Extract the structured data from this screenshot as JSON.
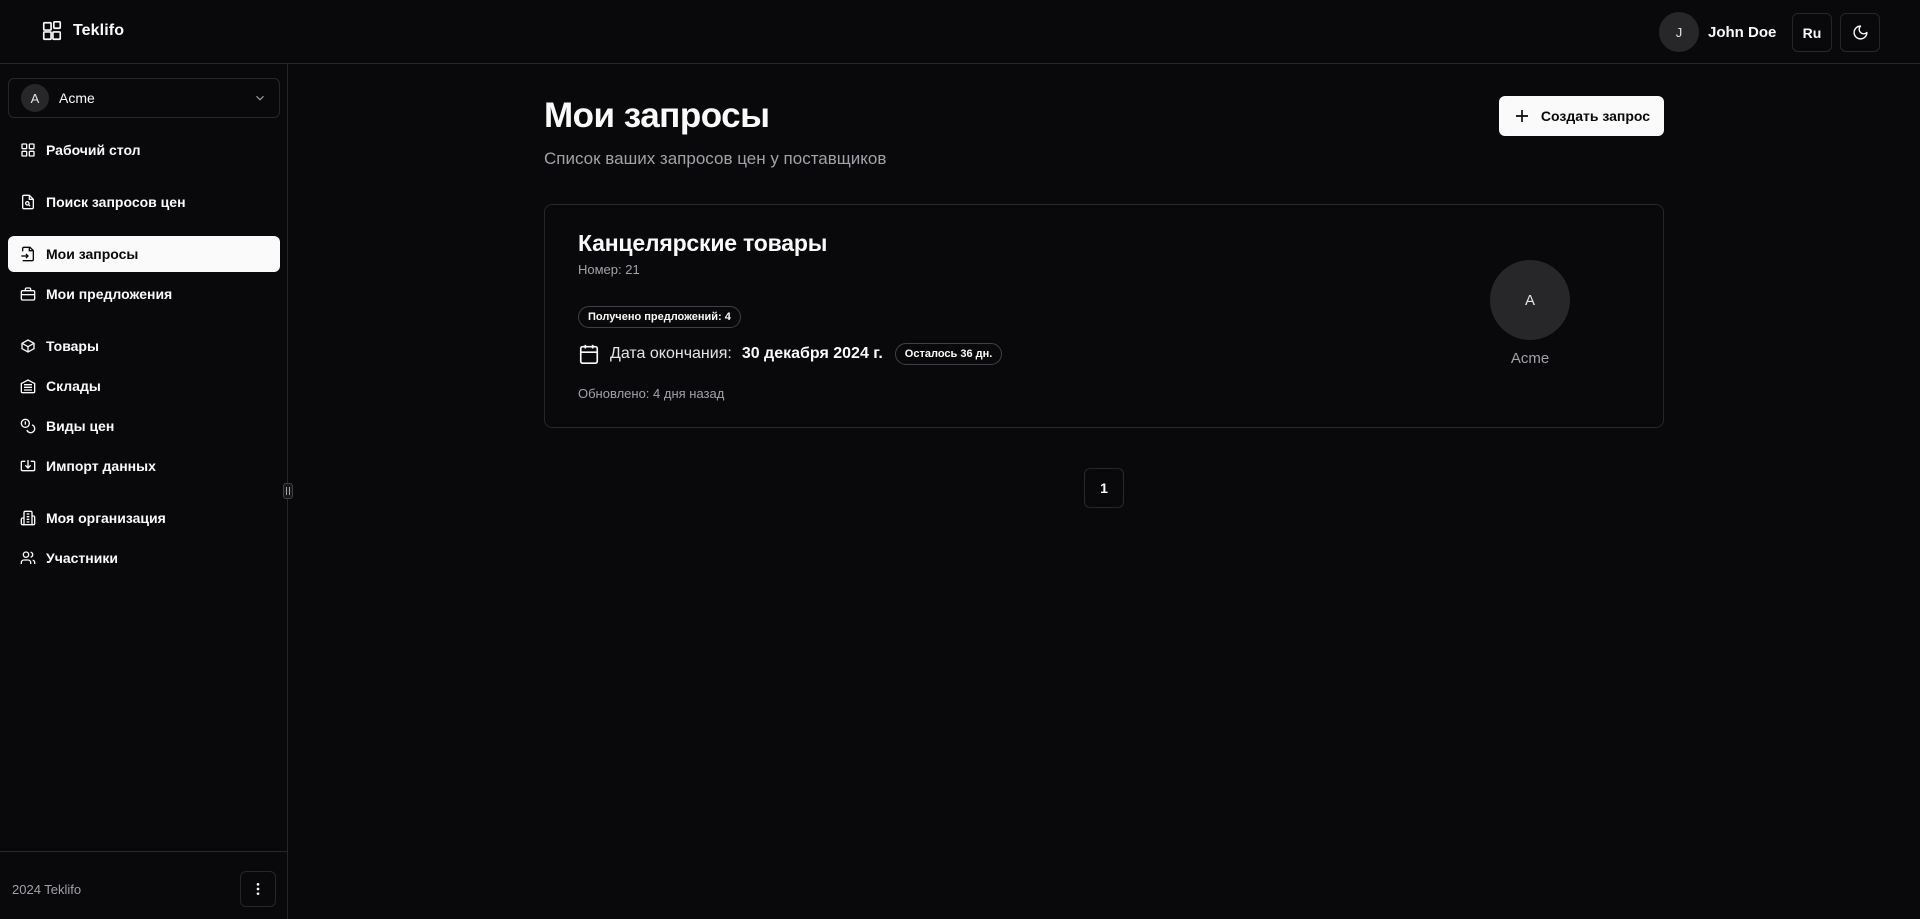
{
  "header": {
    "brand": "Teklifo",
    "user_initial": "J",
    "user_name": "John Doe",
    "language": "Ru"
  },
  "sidebar": {
    "org": {
      "initial": "A",
      "name": "Acme"
    },
    "items": [
      {
        "label": "Рабочий стол",
        "icon": "dashboard-icon"
      },
      {
        "label": "Поиск запросов цен",
        "icon": "file-search-icon"
      },
      {
        "label": "Мои запросы",
        "icon": "file-input-icon",
        "active": true
      },
      {
        "label": "Мои предложения",
        "icon": "briefcase-icon"
      },
      {
        "label": "Товары",
        "icon": "package-icon"
      },
      {
        "label": "Склады",
        "icon": "warehouse-icon"
      },
      {
        "label": "Виды цен",
        "icon": "coins-icon"
      },
      {
        "label": "Импорт данных",
        "icon": "import-icon"
      },
      {
        "label": "Моя организация",
        "icon": "building-icon"
      },
      {
        "label": "Участники",
        "icon": "users-icon"
      }
    ],
    "footer": "2024 Teklifo"
  },
  "main": {
    "title": "Мои запросы",
    "subtitle": "Список ваших запросов цен у поставщиков",
    "create_button": "Создать запрос",
    "requests": [
      {
        "title": "Канцелярские товары",
        "number": "Номер: 21",
        "offers_badge": "Получено предложений: 4",
        "deadline_label": "Дата окончания:",
        "deadline_date": "30 декабря 2024 г.",
        "remaining_badge": "Осталось 36 дн.",
        "updated": "Обновлено: 4 дня назад",
        "supplier_initial": "A",
        "supplier_name": "Acme"
      }
    ],
    "pagination": {
      "current_page": "1"
    }
  },
  "colors": {
    "background": "#09090b",
    "border": "#27272a",
    "foreground": "#fafafa",
    "muted": "#a1a1aa"
  }
}
